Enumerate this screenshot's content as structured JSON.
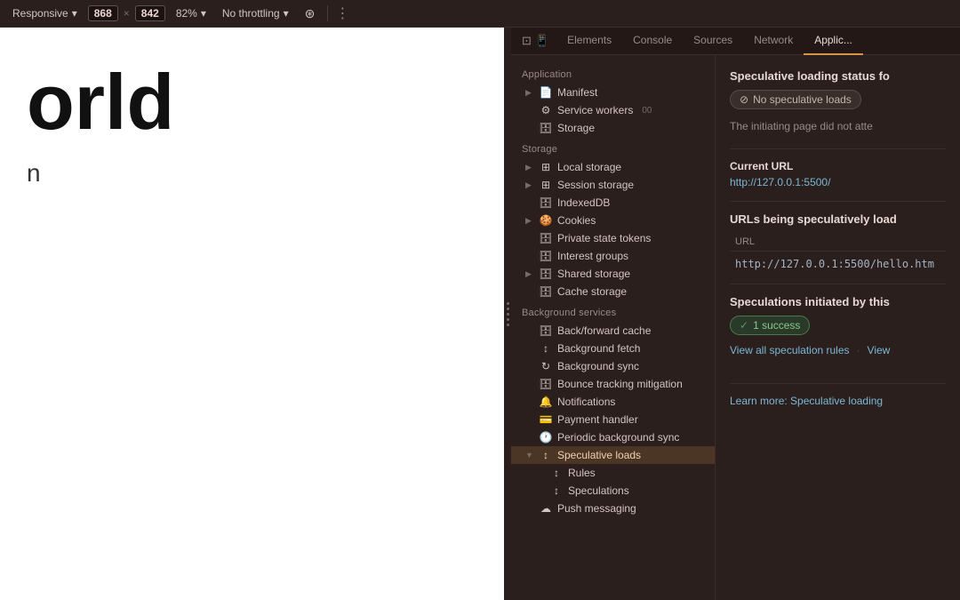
{
  "toolbar": {
    "responsive_label": "Responsive",
    "width_value": "868",
    "height_value": "842",
    "zoom_label": "82%",
    "throttle_label": "No throttling",
    "more_icon": "⋮"
  },
  "preview": {
    "text_large": "orld",
    "text_small": "n"
  },
  "devtools": {
    "tabs": [
      {
        "id": "elements",
        "label": "Elements"
      },
      {
        "id": "console",
        "label": "Console"
      },
      {
        "id": "sources",
        "label": "Sources"
      },
      {
        "id": "network",
        "label": "Network"
      },
      {
        "id": "application",
        "label": "Applic...",
        "active": true
      }
    ],
    "sidebar": {
      "sections": [
        {
          "label": "Application",
          "items": [
            {
              "id": "manifest",
              "label": "Manifest",
              "icon": "doc",
              "expandable": true
            },
            {
              "id": "service-workers",
              "label": "Service workers",
              "icon": "gear",
              "expandable": false,
              "badge": "00"
            },
            {
              "id": "storage",
              "label": "Storage",
              "icon": "db",
              "expandable": false
            }
          ]
        },
        {
          "label": "Storage",
          "items": [
            {
              "id": "local-storage",
              "label": "Local storage",
              "icon": "grid",
              "expandable": true
            },
            {
              "id": "session-storage",
              "label": "Session storage",
              "icon": "grid",
              "expandable": true
            },
            {
              "id": "indexeddb",
              "label": "IndexedDB",
              "icon": "db",
              "expandable": false
            },
            {
              "id": "cookies",
              "label": "Cookies",
              "icon": "cookie",
              "expandable": true
            },
            {
              "id": "private-state-tokens",
              "label": "Private state tokens",
              "icon": "db",
              "expandable": false
            },
            {
              "id": "interest-groups",
              "label": "Interest groups",
              "icon": "db",
              "expandable": false
            },
            {
              "id": "shared-storage",
              "label": "Shared storage",
              "icon": "db",
              "expandable": true
            },
            {
              "id": "cache-storage",
              "label": "Cache storage",
              "icon": "db",
              "expandable": false
            }
          ]
        },
        {
          "label": "Background services",
          "items": [
            {
              "id": "backforward-cache",
              "label": "Back/forward cache",
              "icon": "db",
              "expandable": false
            },
            {
              "id": "background-fetch",
              "label": "Background fetch",
              "icon": "arrow-updown",
              "expandable": false
            },
            {
              "id": "background-sync",
              "label": "Background sync",
              "icon": "sync",
              "expandable": false
            },
            {
              "id": "bounce-tracking",
              "label": "Bounce tracking mitigation",
              "icon": "db",
              "expandable": false
            },
            {
              "id": "notifications",
              "label": "Notifications",
              "icon": "bell",
              "expandable": false
            },
            {
              "id": "payment-handler",
              "label": "Payment handler",
              "icon": "card",
              "expandable": false
            },
            {
              "id": "periodic-bg-sync",
              "label": "Periodic background sync",
              "icon": "clock",
              "expandable": false
            },
            {
              "id": "speculative-loads",
              "label": "Speculative loads",
              "icon": "arrow-updown",
              "expandable": true,
              "expanded": true,
              "active": true
            },
            {
              "id": "rules",
              "label": "Rules",
              "icon": "arrow-updown",
              "sub": true
            },
            {
              "id": "speculations",
              "label": "Speculations",
              "icon": "arrow-updown",
              "sub": true
            },
            {
              "id": "push-messaging",
              "label": "Push messaging",
              "icon": "cloud",
              "expandable": false
            }
          ]
        }
      ]
    },
    "content": {
      "speculative_title": "Speculative loading status fo",
      "no_loads_label": "No speculative loads",
      "desc_text": "The initiating page did not atte",
      "current_url_label": "Current URL",
      "current_url_value": "http://127.0.0.1:5500/",
      "urls_title": "URLs being speculatively load",
      "url_header": "URL",
      "url_value": "http://127.0.0.1:5500/hello.htm",
      "speculations_title": "Speculations initiated by this",
      "success_badge": "1 success",
      "view_rules_link": "View all speculation rules",
      "view_link2": "View",
      "learn_more_link": "Learn more: Speculative loading"
    }
  }
}
